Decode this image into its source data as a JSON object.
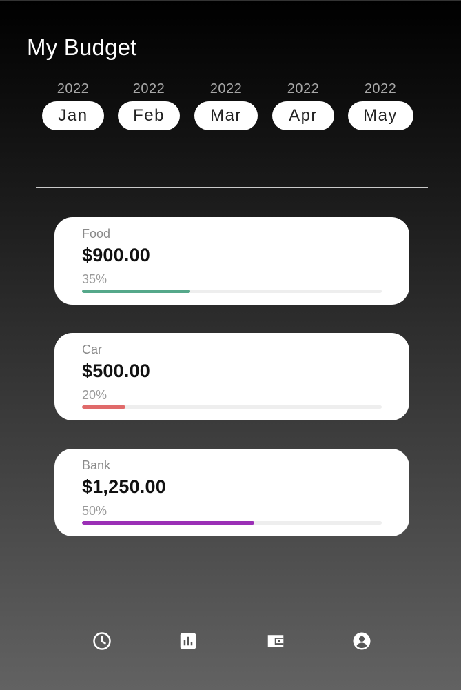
{
  "header": {
    "title": "My Budget"
  },
  "months": [
    {
      "year": "2022",
      "label": "Jan"
    },
    {
      "year": "2022",
      "label": "Feb"
    },
    {
      "year": "2022",
      "label": "Mar"
    },
    {
      "year": "2022",
      "label": "Apr"
    },
    {
      "year": "2022",
      "label": "May"
    }
  ],
  "categories": [
    {
      "name": "Food",
      "amount": "$900.00",
      "percent_label": "35%",
      "progress": 0.36,
      "color": "#55a88a"
    },
    {
      "name": "Car",
      "amount": "$500.00",
      "percent_label": "20%",
      "progress": 0.145,
      "color": "#e06a6a"
    },
    {
      "name": "Bank",
      "amount": "$1,250.00",
      "percent_label": "50%",
      "progress": 0.575,
      "color": "#9b2fb6"
    }
  ],
  "bottom_nav": {
    "items": [
      {
        "icon": "clock-icon"
      },
      {
        "icon": "bar-chart-icon"
      },
      {
        "icon": "wallet-icon"
      },
      {
        "icon": "account-circle-icon"
      }
    ]
  },
  "colors": {
    "nav_icon": "#ffffff",
    "card_bg": "#ffffff",
    "track": "#eeeeee"
  }
}
